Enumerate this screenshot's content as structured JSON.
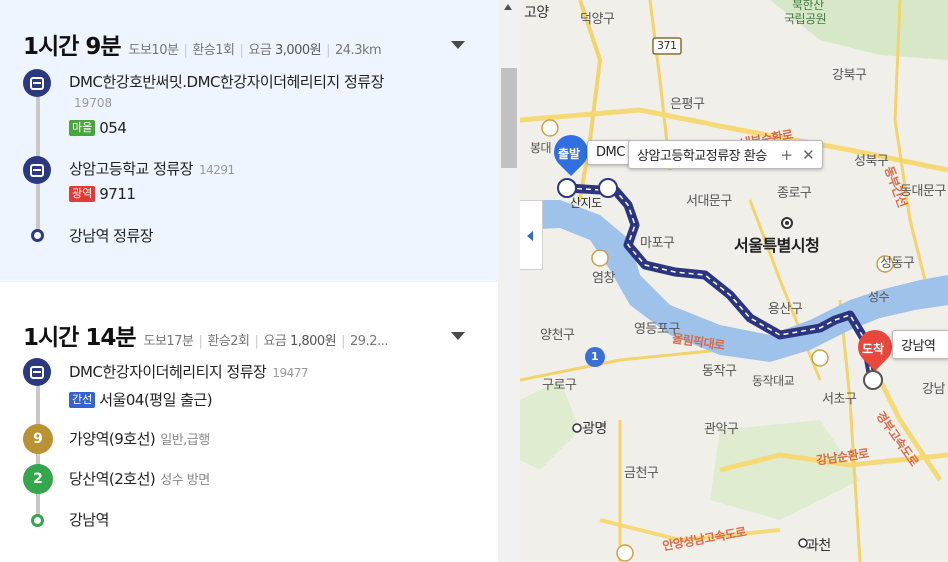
{
  "routes": [
    {
      "duration": "1시간 9분",
      "walk": "도보10분",
      "transfers": "환승1회",
      "fare_label": "요금",
      "fare_value": "3,000원",
      "distance": "24.3km",
      "steps": [
        {
          "name": "DMC한강호반써밋.DMC한강자이더헤리티지 정류장",
          "code": "19708",
          "tag": "마을",
          "line": "054"
        },
        {
          "name": "상암고등학교 정류장",
          "code": "14291",
          "tag": "광역",
          "line": "9711"
        },
        {
          "name": "강남역 정류장"
        }
      ]
    },
    {
      "duration": "1시간 14분",
      "walk": "도보17분",
      "transfers": "환승2회",
      "fare_label": "요금",
      "fare_value": "1,800원",
      "distance": "29.2...",
      "steps": [
        {
          "name": "DMC한강자이더헤리티지 정류장",
          "code": "19477",
          "tag": "간선",
          "line": "서울04(평일 출근)"
        },
        {
          "icon": "9",
          "name": "가양역(9호선)",
          "note": "일반,급행"
        },
        {
          "icon": "2",
          "name": "당산역(2호선)",
          "note": "성수 방면"
        },
        {
          "name": "강남역"
        }
      ]
    }
  ],
  "map": {
    "labels": {
      "goyang": "고양",
      "deogyang": "덕양구",
      "bukhansan": "북한산",
      "national_park": "국립공원",
      "gangbuk": "강북구",
      "route371": "371",
      "eunpyeong": "은평구",
      "seongbuk": "성북구",
      "seodaemun": "서대문구",
      "jongno": "종로구",
      "dongdaemun": "동대문구",
      "city_hall": "서울특별시청",
      "mapo": "마포구",
      "seongdong": "성동구",
      "yeomchang": "염창",
      "yongsan": "용산구",
      "seongsu": "성수",
      "yangcheon": "양천구",
      "yeongdeungpo": "영등포구",
      "olympic_road": "올림픽대로",
      "guro": "구로구",
      "dongjak": "동작구",
      "dongjak_bridge": "동작대교",
      "seocho": "서초구",
      "gangnam": "강남",
      "gwangmyeong": "광명",
      "gwanak": "관악구",
      "geumcheon": "금천구",
      "gangnam_sunhwan": "강남순환로",
      "anyang_road": "안양성남고속도로",
      "gwacheon": "과천",
      "gyeongbu": "경부고속도로",
      "naebu": "내부순환로",
      "dongbu": "동부간선",
      "bonghwa": "봉대",
      "hoe_sindo": "산지도",
      "ring1": "1"
    },
    "start_label": "출발",
    "end_label": "도착",
    "start_callout_prefix": "DMC",
    "transfer_callout": "상암고등학교정류장 환승",
    "end_callout": "강남역",
    "callout_plus": "+",
    "callout_close": "✕"
  },
  "colors": {
    "route_line": "#2c3680",
    "start_pin": "#2f6fe0",
    "end_pin": "#e8483c",
    "river": "#9fc2ea"
  }
}
